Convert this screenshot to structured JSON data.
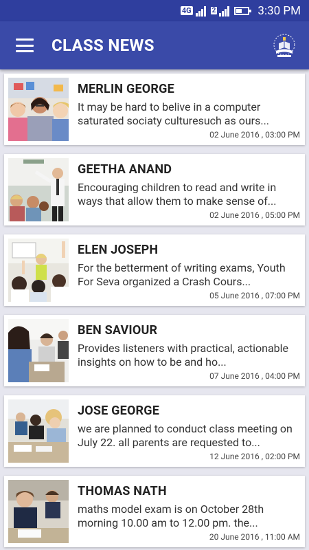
{
  "status_bar": {
    "network": "4G",
    "sim_badge": "2",
    "time": "3:30 PM"
  },
  "header": {
    "title": "CLASS NEWS",
    "menu_icon": "hamburger-menu-icon",
    "logo_icon": "school-logo-icon"
  },
  "colors": {
    "primary": "#3a4aa8",
    "status_bar": "#2f3e9e",
    "background": "#e6e6ef"
  },
  "news": [
    {
      "name": "MERLIN GEORGE",
      "description": "It may be hard to belive in a computer saturated sociaty culturesuch as ours...",
      "date": "02 June 2016 , 03:00 PM",
      "image": "teacher-with-children-image"
    },
    {
      "name": "GEETHA ANAND",
      "description": "Encouraging children to read and write in ways that allow them to make sense of...",
      "date": "02 June 2016 , 05:00 PM",
      "image": "teacher-at-board-image"
    },
    {
      "name": "ELEN JOSEPH",
      "description": "For the betterment of writing exams, Youth For Seva organized a Crash Cours...",
      "date": "05 June 2016 , 07:00 PM",
      "image": "classroom-raising-hands-image"
    },
    {
      "name": "BEN SAVIOUR",
      "description": "Provides listeners with practical, actionable insights on how to be and ho...",
      "date": "07 June 2016 , 04:00 PM",
      "image": "students-writing-image"
    },
    {
      "name": "JOSE GEORGE",
      "description": "we are planned to conduct class meeting on July 22. all parents are requested to...",
      "date": "12 June 2016 , 02:00 PM",
      "image": "students-at-desks-image"
    },
    {
      "name": "THOMAS NATH",
      "description": "maths model exam is on October 28th morning 10.00 am to 12.00 pm. the...",
      "date": "20 June 2016 , 11:00 AM",
      "image": "students-taking-exam-image"
    }
  ]
}
